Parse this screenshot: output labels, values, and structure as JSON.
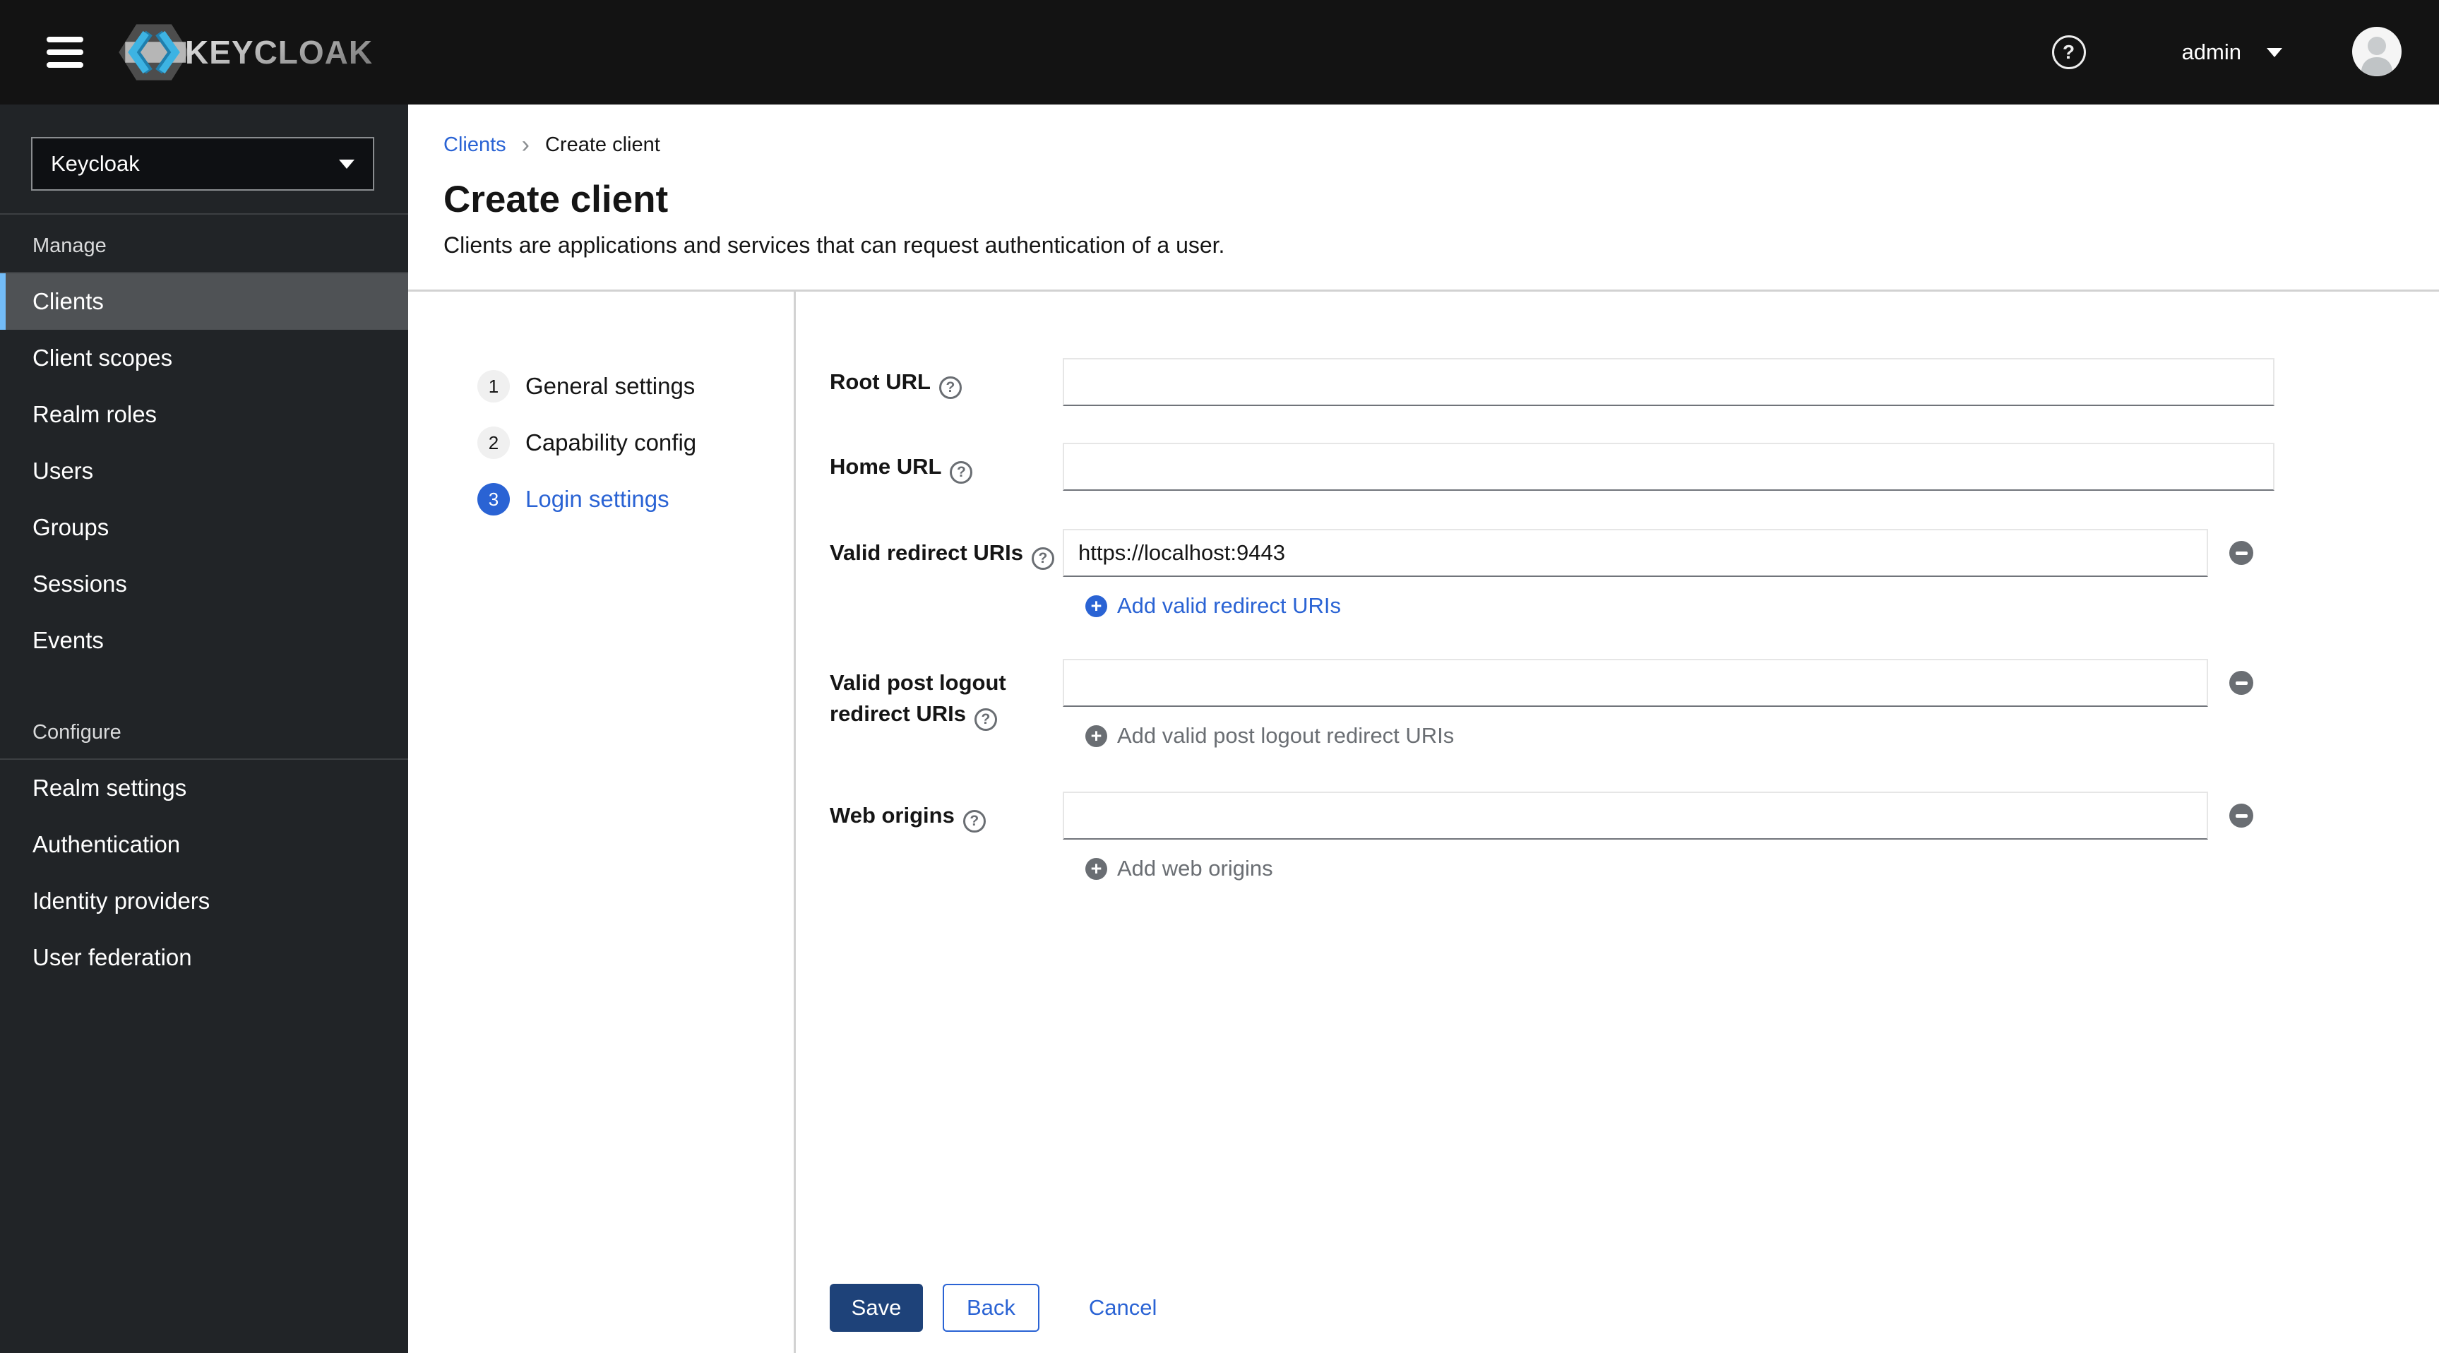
{
  "header": {
    "brand": "KEYCLOAK",
    "username": "admin"
  },
  "sidebar": {
    "realm_selector": {
      "value": "Keycloak"
    },
    "sections": [
      {
        "title": "Manage",
        "items": [
          {
            "label": "Clients",
            "active": true
          },
          {
            "label": "Client scopes"
          },
          {
            "label": "Realm roles"
          },
          {
            "label": "Users"
          },
          {
            "label": "Groups"
          },
          {
            "label": "Sessions"
          },
          {
            "label": "Events"
          }
        ]
      },
      {
        "title": "Configure",
        "items": [
          {
            "label": "Realm settings"
          },
          {
            "label": "Authentication"
          },
          {
            "label": "Identity providers"
          },
          {
            "label": "User federation"
          }
        ]
      }
    ]
  },
  "breadcrumb": {
    "separator": "›",
    "items": [
      {
        "label": "Clients"
      },
      {
        "label": "Create client"
      }
    ]
  },
  "page": {
    "title": "Create client",
    "description": "Clients are applications and services that can request authentication of a user."
  },
  "wizard": {
    "steps": [
      {
        "number": "1",
        "label": "General settings"
      },
      {
        "number": "2",
        "label": "Capability config"
      },
      {
        "number": "3",
        "label": "Login settings",
        "active": true
      }
    ],
    "form": {
      "fields": [
        {
          "label": "Root URL",
          "value": ""
        },
        {
          "label": "Home URL",
          "value": ""
        },
        {
          "label": "Valid redirect URIs",
          "value": "https://localhost:9443",
          "add_label": "Add valid redirect URIs",
          "add_enabled": true
        },
        {
          "label": "Valid post logout redirect URIs",
          "value": "",
          "add_label": "Add valid post logout redirect URIs",
          "add_enabled": false
        },
        {
          "label": "Web origins",
          "value": "",
          "add_label": "Add web origins",
          "add_enabled": false
        }
      ],
      "help_glyph": "?"
    },
    "footer": {
      "save_label": "Save",
      "back_label": "Back",
      "cancel_label": "Cancel"
    }
  },
  "colors": {
    "accent": "#2a63d4",
    "save-bg": "#1e4279",
    "masthead-bg": "#131313",
    "sidebar-bg": "#212427",
    "active-item-bg": "#4f5255",
    "active-stripe": "#73bcf7",
    "divider": "#d2d2d2",
    "disabled-text": "#6a6e73",
    "logo-blue": "#3db3e3"
  }
}
